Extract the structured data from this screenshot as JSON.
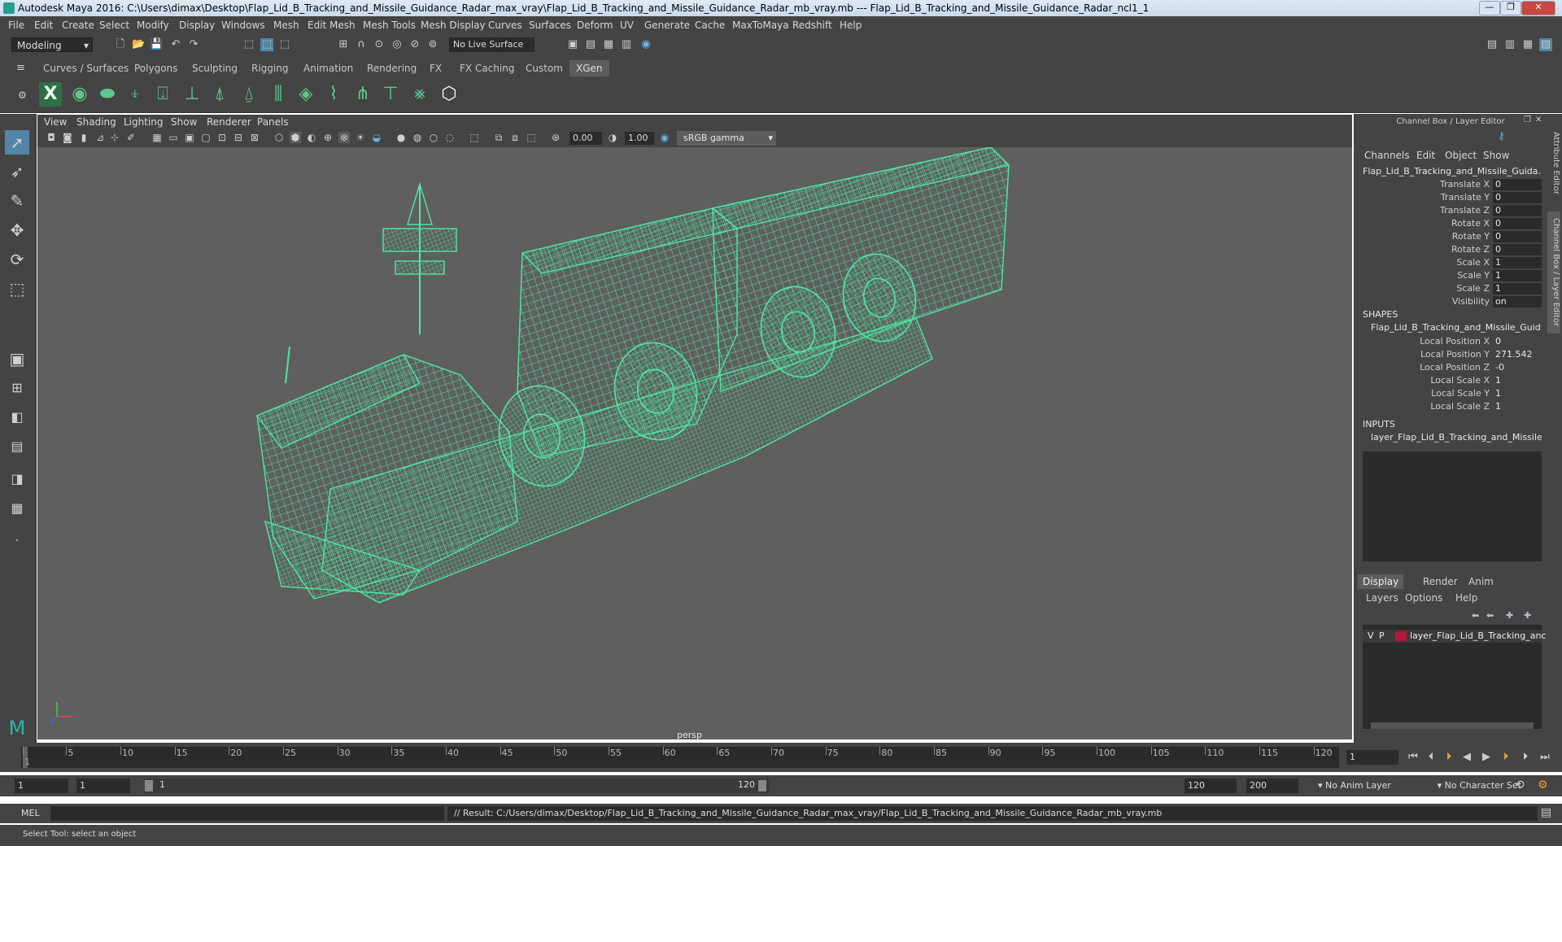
{
  "window": {
    "title": "Autodesk Maya 2016: C:\\Users\\dimax\\Desktop\\Flap_Lid_B_Tracking_and_Missile_Guidance_Radar_max_vray\\Flap_Lid_B_Tracking_and_Missile_Guidance_Radar_mb_vray.mb   ---   Flap_Lid_B_Tracking_and_Missile_Guidance_Radar_ncl1_1",
    "minimize": "—",
    "restore": "❐",
    "close": "✕"
  },
  "menu": [
    "File",
    "Edit",
    "Create",
    "Select",
    "Modify",
    "Display",
    "Windows",
    "Mesh",
    "Edit Mesh",
    "Mesh Tools",
    "Mesh Display",
    "Curves",
    "Surfaces",
    "Deform",
    "UV",
    "Generate",
    "Cache",
    "MaxToMaya",
    "Redshift",
    "Help"
  ],
  "statusline": {
    "mode": "Modeling",
    "live_surface": "No Live Surface"
  },
  "shelf_tabs": [
    "Curves / Surfaces",
    "Polygons",
    "Sculpting",
    "Rigging",
    "Animation",
    "Rendering",
    "FX",
    "FX Caching",
    "Custom",
    "XGen"
  ],
  "shelf_active": "XGen",
  "panel_menu": [
    "View",
    "Shading",
    "Lighting",
    "Show",
    "Renderer",
    "Panels"
  ],
  "panel_tools": {
    "exposure": "0.00",
    "gamma_value": "1.00",
    "color_space": "sRGB gamma"
  },
  "viewport": {
    "camera_label": "persp",
    "wire_color": "#4de8a0"
  },
  "channel_box": {
    "title": "Channel Box / Layer Editor",
    "tabs": [
      "Channels",
      "Edit",
      "Object",
      "Show"
    ],
    "object_name": "Flap_Lid_B_Tracking_and_Missile_Guida...",
    "attributes": [
      {
        "label": "Translate X",
        "value": "0"
      },
      {
        "label": "Translate Y",
        "value": "0"
      },
      {
        "label": "Translate Z",
        "value": "0"
      },
      {
        "label": "Rotate X",
        "value": "0"
      },
      {
        "label": "Rotate Y",
        "value": "0"
      },
      {
        "label": "Rotate Z",
        "value": "0"
      },
      {
        "label": "Scale X",
        "value": "1"
      },
      {
        "label": "Scale Y",
        "value": "1"
      },
      {
        "label": "Scale Z",
        "value": "1"
      },
      {
        "label": "Visibility",
        "value": "on"
      }
    ],
    "shapes_header": "SHAPES",
    "shape_name": "Flap_Lid_B_Tracking_and_Missile_Guid...",
    "shape_attributes": [
      {
        "label": "Local Position X",
        "value": "0"
      },
      {
        "label": "Local Position Y",
        "value": "271.542"
      },
      {
        "label": "Local Position Z",
        "value": "-0"
      },
      {
        "label": "Local Scale X",
        "value": "1"
      },
      {
        "label": "Local Scale Y",
        "value": "1"
      },
      {
        "label": "Local Scale Z",
        "value": "1"
      }
    ],
    "inputs_header": "INPUTS",
    "input_name": "layer_Flap_Lid_B_Tracking_and_Missile..."
  },
  "layer_editor": {
    "tabs": [
      "Display",
      "Render",
      "Anim"
    ],
    "menu": [
      "Layers",
      "Options",
      "Help"
    ],
    "layer": {
      "v": "V",
      "p": "P",
      "name": "layer_Flap_Lid_B_Tracking_anc",
      "color": "#b5163a"
    }
  },
  "side_tabs": [
    "Attribute Editor",
    "Channel Box / Layer Editor"
  ],
  "timeline": {
    "ticks": [
      "1",
      "5",
      "10",
      "15",
      "20",
      "25",
      "30",
      "35",
      "40",
      "45",
      "50",
      "55",
      "60",
      "65",
      "70",
      "75",
      "80",
      "85",
      "90",
      "95",
      "100",
      "105",
      "110",
      "115",
      "120"
    ],
    "current_frame": "1"
  },
  "range": {
    "start": "1",
    "playback_start": "1",
    "slider_start": "1",
    "slider_end": "120",
    "playback_end": "120",
    "end": "200",
    "anim_layer": "No Anim Layer",
    "char_set": "No Character Set"
  },
  "command": {
    "lang": "MEL",
    "result": "// Result: C:/Users/dimax/Desktop/Flap_Lid_B_Tracking_and_Missile_Guidance_Radar_max_vray/Flap_Lid_B_Tracking_and_Missile_Guidance_Radar_mb_vray.mb"
  },
  "help_line": "Select Tool: select an object"
}
